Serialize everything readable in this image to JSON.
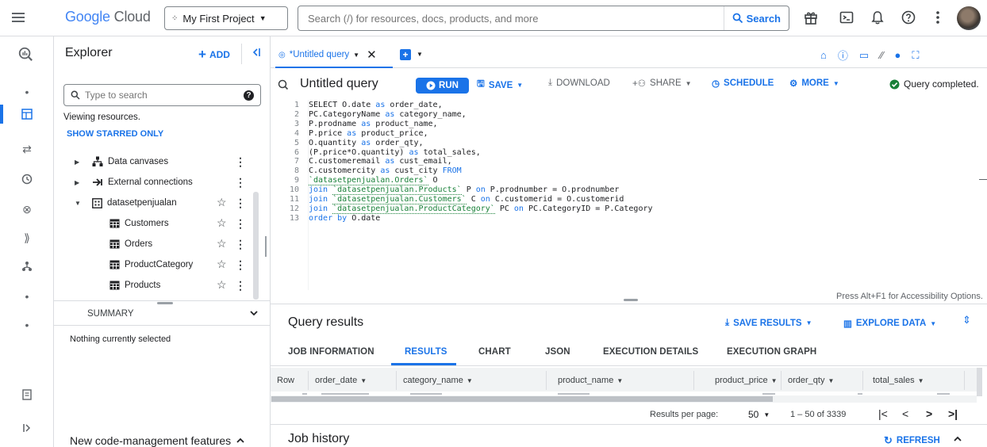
{
  "topbar": {
    "logo_google": "Google",
    "logo_cloud": " Cloud",
    "project": "My First Project",
    "search_placeholder": "Search (/) for resources, docs, products, and more",
    "search_button": "Search"
  },
  "explorer": {
    "title": "Explorer",
    "add_label": "ADD",
    "search_placeholder": "Type to search",
    "viewing": "Viewing resources.",
    "show_starred": "SHOW STARRED ONLY",
    "tree": [
      {
        "label": "Data canvases"
      },
      {
        "label": "External connections"
      },
      {
        "label": "datasetpenjualan"
      },
      {
        "label": "Customers"
      },
      {
        "label": "Orders"
      },
      {
        "label": "ProductCategory"
      },
      {
        "label": "Products"
      }
    ],
    "summary_label": "SUMMARY",
    "nothing_selected": "Nothing currently selected",
    "code_mgmt": "New code-management features"
  },
  "editor": {
    "tab_label": "*Untitled query",
    "title": "Untitled query",
    "run": "RUN",
    "save": "SAVE",
    "download": "DOWNLOAD",
    "share": "SHARE",
    "schedule": "SCHEDULE",
    "more": "MORE",
    "status": "Query completed.",
    "accessibility": "Press Alt+F1 for Accessibility Options.",
    "lines": [
      {
        "n": "1",
        "p": [
          {
            "t": "SELECT O.date ",
            "c": "kw0"
          },
          {
            "t": "as",
            "c": "kw"
          },
          {
            "t": " order_date,",
            "c": ""
          }
        ]
      },
      {
        "n": "2",
        "p": [
          {
            "t": "PC.CategoryName ",
            "c": ""
          },
          {
            "t": "as",
            "c": "kw"
          },
          {
            "t": " category_name,",
            "c": ""
          }
        ]
      },
      {
        "n": "3",
        "p": [
          {
            "t": "P.prodname ",
            "c": ""
          },
          {
            "t": "as",
            "c": "kw"
          },
          {
            "t": " product_name,",
            "c": ""
          }
        ]
      },
      {
        "n": "4",
        "p": [
          {
            "t": "P.price ",
            "c": ""
          },
          {
            "t": "as",
            "c": "kw"
          },
          {
            "t": " product_price,",
            "c": ""
          }
        ]
      },
      {
        "n": "5",
        "p": [
          {
            "t": "O.quantity ",
            "c": ""
          },
          {
            "t": "as",
            "c": "kw"
          },
          {
            "t": " order_qty,",
            "c": ""
          }
        ]
      },
      {
        "n": "6",
        "p": [
          {
            "t": "(P.price*O.quantity) ",
            "c": ""
          },
          {
            "t": "as",
            "c": "kw"
          },
          {
            "t": " total_sales,",
            "c": ""
          }
        ]
      },
      {
        "n": "7",
        "p": [
          {
            "t": "C.customeremail ",
            "c": ""
          },
          {
            "t": "as",
            "c": "kw"
          },
          {
            "t": " cust_email,",
            "c": ""
          }
        ]
      },
      {
        "n": "8",
        "p": [
          {
            "t": "C.customercity ",
            "c": ""
          },
          {
            "t": "as",
            "c": "kw"
          },
          {
            "t": " cust_city ",
            "c": ""
          },
          {
            "t": "FROM",
            "c": "kw"
          }
        ]
      },
      {
        "n": "9",
        "p": [
          {
            "t": "`datasetpenjualan.Orders`",
            "c": "tbl"
          },
          {
            "t": " O",
            "c": ""
          }
        ]
      },
      {
        "n": "10",
        "p": [
          {
            "t": "join ",
            "c": "kw"
          },
          {
            "t": "`datasetpenjualan.Products`",
            "c": "tbl"
          },
          {
            "t": " P ",
            "c": ""
          },
          {
            "t": "on",
            "c": "kw"
          },
          {
            "t": " P.prodnumber = O.prodnumber",
            "c": ""
          }
        ]
      },
      {
        "n": "11",
        "p": [
          {
            "t": "join ",
            "c": "kw"
          },
          {
            "t": "`datasetpenjualan.Customers`",
            "c": "tbl"
          },
          {
            "t": " C ",
            "c": ""
          },
          {
            "t": "on",
            "c": "kw"
          },
          {
            "t": " C.customerid = O.customerid",
            "c": ""
          }
        ]
      },
      {
        "n": "12",
        "p": [
          {
            "t": "join ",
            "c": "kw"
          },
          {
            "t": "`datasetpenjualan.ProductCategory`",
            "c": "tbl"
          },
          {
            "t": " PC ",
            "c": ""
          },
          {
            "t": "on",
            "c": "kw"
          },
          {
            "t": " PC.CategoryID = P.Category",
            "c": ""
          }
        ]
      },
      {
        "n": "13",
        "p": [
          {
            "t": "order by",
            "c": "kw"
          },
          {
            "t": " O.date",
            "c": ""
          }
        ]
      }
    ]
  },
  "results": {
    "title": "Query results",
    "save_results": "SAVE RESULTS",
    "explore_data": "EXPLORE DATA",
    "tabs": [
      "JOB INFORMATION",
      "RESULTS",
      "CHART",
      "JSON",
      "EXECUTION DETAILS",
      "EXECUTION GRAPH"
    ],
    "active_tab": 1,
    "columns": [
      "Row",
      "order_date",
      "category_name",
      "product_name",
      "product_price",
      "order_qty",
      "total_sales"
    ],
    "per_page_label": "Results per page:",
    "per_page": "50",
    "range": "1 – 50 of 3339",
    "job_history": "Job history",
    "refresh": "REFRESH"
  },
  "colors": {
    "accent": "#1a73e8",
    "green": "#188038"
  }
}
